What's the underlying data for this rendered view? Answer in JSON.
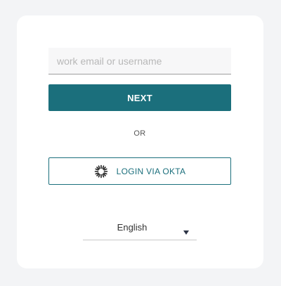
{
  "login": {
    "email_placeholder": "work email or username",
    "email_value": "",
    "next_label": "NEXT",
    "separator": "OR",
    "okta_label": "LOGIN VIA OKTA",
    "okta_icon": "okta-sunburst-icon"
  },
  "language": {
    "selected": "English",
    "icon": "chevron-down-icon"
  },
  "colors": {
    "accent": "#1b6f7c",
    "background": "#f3f4f6",
    "card": "#ffffff"
  }
}
